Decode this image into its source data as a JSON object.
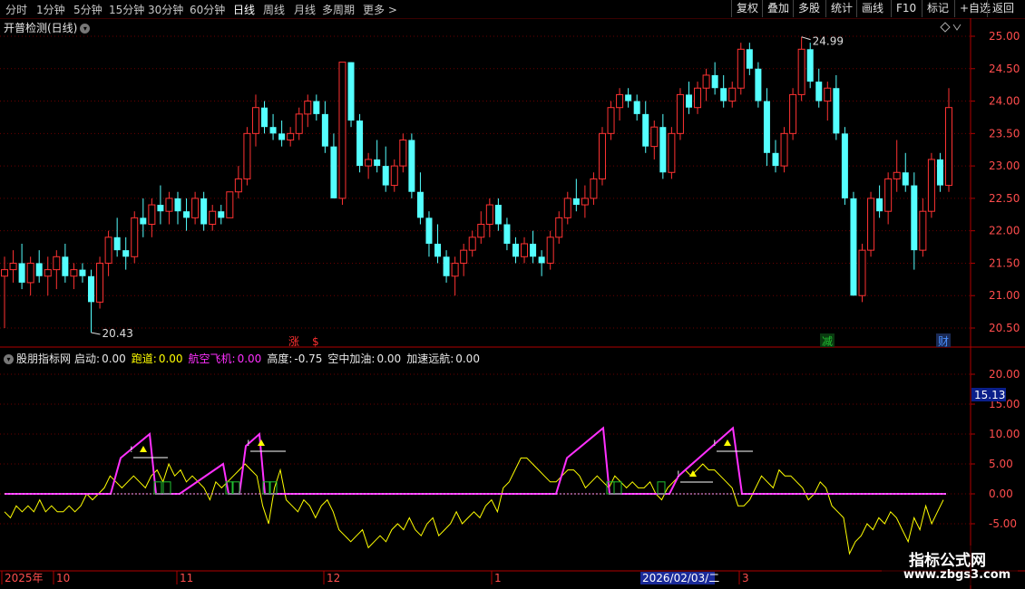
{
  "toolbar": {
    "periods": [
      "分时",
      "1分钟",
      "5分钟",
      "15分钟",
      "30分钟",
      "60分钟",
      "日线",
      "周线",
      "月线",
      "多周期",
      "更多 >"
    ],
    "active_period": "日线",
    "right_buttons": [
      "复权",
      "叠加",
      "多股",
      "统计",
      "画线",
      "F10",
      "标记",
      "+自选",
      "返回"
    ]
  },
  "main_chart": {
    "title": "开普检测(日线)",
    "high_label": "24.99",
    "low_label": "20.43",
    "price_ticks": [
      "25.00",
      "24.50",
      "24.00",
      "23.50",
      "23.00",
      "22.50",
      "22.00",
      "21.50",
      "21.00",
      "20.50"
    ],
    "markers": [
      {
        "text": "涨",
        "color": "#ff3030"
      },
      {
        "text": "$",
        "color": "#ff3030"
      },
      {
        "text": "减",
        "color": "#20c030"
      },
      {
        "text": "财",
        "color": "#4a90ff"
      }
    ]
  },
  "indicator": {
    "name": "股朋指标网",
    "items": [
      {
        "label": "启动:",
        "value": "0.00",
        "color": "#e8e8e8"
      },
      {
        "label": "跑道:",
        "value": "0.00",
        "color": "#ffff00"
      },
      {
        "label": "航空飞机:",
        "value": "0.00",
        "color": "#ff30ff"
      },
      {
        "label": "高度:",
        "value": "-0.75",
        "color": "#e8e8e8"
      },
      {
        "label": "空中加油:",
        "value": "0.00",
        "color": "#e8e8e8"
      },
      {
        "label": "加速远航:",
        "value": "0.00",
        "color": "#e8e8e8"
      }
    ],
    "ticks": [
      "20.00",
      "15.00",
      "10.00",
      "5.00",
      "0.00",
      "-5.00"
    ],
    "current_value": "15.13"
  },
  "time_axis": {
    "labels": [
      "2025年",
      "10",
      "11",
      "12",
      "1",
      "2",
      "3"
    ],
    "cursor_date": "2026/02/03/二"
  },
  "watermark": {
    "line1": "指标公式网",
    "line2": "www.zbgs3.com"
  },
  "colors": {
    "up": "#ff3232",
    "down": "#54ffff",
    "flat": "#ffffff",
    "axis": "#b00000",
    "yellow": "#ffff00",
    "magenta": "#ff30ff",
    "green": "#20c030"
  },
  "chart_data": {
    "type": "candlestick",
    "series": [
      {
        "values": [
          [
            21.3,
            21.6,
            20.5,
            21.4
          ],
          [
            21.4,
            21.7,
            21.2,
            21.5
          ],
          [
            21.5,
            21.8,
            21.1,
            21.2
          ],
          [
            21.2,
            21.6,
            21.0,
            21.5
          ],
          [
            21.5,
            21.7,
            21.2,
            21.3
          ],
          [
            21.3,
            21.6,
            21.0,
            21.4
          ],
          [
            21.4,
            21.7,
            21.1,
            21.6
          ],
          [
            21.6,
            21.8,
            21.2,
            21.3
          ],
          [
            21.3,
            21.5,
            21.1,
            21.4
          ],
          [
            21.4,
            21.5,
            21.2,
            21.3
          ],
          [
            21.3,
            21.4,
            20.43,
            20.9
          ],
          [
            20.9,
            21.6,
            20.8,
            21.5
          ],
          [
            21.5,
            22.0,
            21.3,
            21.9
          ],
          [
            21.9,
            22.2,
            21.6,
            21.7
          ],
          [
            21.7,
            21.9,
            21.4,
            21.6
          ],
          [
            21.6,
            22.3,
            21.5,
            22.2
          ],
          [
            22.2,
            22.5,
            21.9,
            22.1
          ],
          [
            22.1,
            22.5,
            21.9,
            22.4
          ],
          [
            22.4,
            22.7,
            22.1,
            22.3
          ],
          [
            22.3,
            22.6,
            22.1,
            22.5
          ],
          [
            22.5,
            22.6,
            22.1,
            22.3
          ],
          [
            22.3,
            22.5,
            22.0,
            22.2
          ],
          [
            22.2,
            22.6,
            22.1,
            22.5
          ],
          [
            22.5,
            22.6,
            22.0,
            22.1
          ],
          [
            22.1,
            22.4,
            22.0,
            22.3
          ],
          [
            22.3,
            22.4,
            22.1,
            22.2
          ],
          [
            22.2,
            22.6,
            22.2,
            22.6
          ],
          [
            22.6,
            23.0,
            22.5,
            22.8
          ],
          [
            22.8,
            23.6,
            22.7,
            23.5
          ],
          [
            23.5,
            24.1,
            23.3,
            23.9
          ],
          [
            23.9,
            24.0,
            23.5,
            23.6
          ],
          [
            23.6,
            23.8,
            23.4,
            23.5
          ],
          [
            23.5,
            23.7,
            23.3,
            23.4
          ],
          [
            23.4,
            23.6,
            23.3,
            23.5
          ],
          [
            23.5,
            23.9,
            23.4,
            23.8
          ],
          [
            23.8,
            24.1,
            23.6,
            24.0
          ],
          [
            24.0,
            24.1,
            23.7,
            23.8
          ],
          [
            23.8,
            24.0,
            23.2,
            23.3
          ],
          [
            23.3,
            23.5,
            22.6,
            22.5
          ],
          [
            22.5,
            24.6,
            22.4,
            24.6
          ],
          [
            24.6,
            24.6,
            23.6,
            23.7
          ],
          [
            23.7,
            23.8,
            22.9,
            23.0
          ],
          [
            23.0,
            23.2,
            22.8,
            23.1
          ],
          [
            23.1,
            23.4,
            22.9,
            23.0
          ],
          [
            23.0,
            23.3,
            22.6,
            22.7
          ],
          [
            22.7,
            23.1,
            22.6,
            23.0
          ],
          [
            23.0,
            23.5,
            22.9,
            23.4
          ],
          [
            23.4,
            23.5,
            22.5,
            22.6
          ],
          [
            22.6,
            22.9,
            22.1,
            22.2
          ],
          [
            22.2,
            22.3,
            21.6,
            21.8
          ],
          [
            21.8,
            22.1,
            21.5,
            21.6
          ],
          [
            21.6,
            21.7,
            21.2,
            21.3
          ],
          [
            21.3,
            21.6,
            21.0,
            21.5
          ],
          [
            21.5,
            21.8,
            21.3,
            21.7
          ],
          [
            21.7,
            22.0,
            21.6,
            21.9
          ],
          [
            21.9,
            22.3,
            21.8,
            22.1
          ],
          [
            22.1,
            22.5,
            21.9,
            22.4
          ],
          [
            22.4,
            22.5,
            22.0,
            22.1
          ],
          [
            22.1,
            22.2,
            21.7,
            21.8
          ],
          [
            21.8,
            21.9,
            21.5,
            21.6
          ],
          [
            21.6,
            21.9,
            21.5,
            21.8
          ],
          [
            21.8,
            22.0,
            21.5,
            21.6
          ],
          [
            21.6,
            21.7,
            21.3,
            21.5
          ],
          [
            21.5,
            22.0,
            21.4,
            21.9
          ],
          [
            21.9,
            22.3,
            21.8,
            22.2
          ],
          [
            22.2,
            22.6,
            22.1,
            22.5
          ],
          [
            22.5,
            22.8,
            22.3,
            22.4
          ],
          [
            22.4,
            22.7,
            22.2,
            22.5
          ],
          [
            22.5,
            22.9,
            22.4,
            22.8
          ],
          [
            22.8,
            23.6,
            22.7,
            23.5
          ],
          [
            23.5,
            24.0,
            23.4,
            23.9
          ],
          [
            23.9,
            24.2,
            23.7,
            24.1
          ],
          [
            24.1,
            24.2,
            23.9,
            24.0
          ],
          [
            24.0,
            24.1,
            23.7,
            23.8
          ],
          [
            23.8,
            24.0,
            23.2,
            23.3
          ],
          [
            23.3,
            23.7,
            23.1,
            23.6
          ],
          [
            23.6,
            23.8,
            22.8,
            22.9
          ],
          [
            22.9,
            23.6,
            22.8,
            23.5
          ],
          [
            23.5,
            24.2,
            23.4,
            24.1
          ],
          [
            24.1,
            24.3,
            23.8,
            23.9
          ],
          [
            23.9,
            24.3,
            23.8,
            24.2
          ],
          [
            24.2,
            24.5,
            24.0,
            24.4
          ],
          [
            24.4,
            24.6,
            24.1,
            24.2
          ],
          [
            24.2,
            24.4,
            23.9,
            24.0
          ],
          [
            24.0,
            24.3,
            23.9,
            24.2
          ],
          [
            24.2,
            24.9,
            24.1,
            24.8
          ],
          [
            24.8,
            24.9,
            24.4,
            24.5
          ],
          [
            24.5,
            24.6,
            23.9,
            24.0
          ],
          [
            24.0,
            24.2,
            23.0,
            23.2
          ],
          [
            23.2,
            23.4,
            22.9,
            23.0
          ],
          [
            23.0,
            23.6,
            22.9,
            23.5
          ],
          [
            23.5,
            24.2,
            23.4,
            24.1
          ],
          [
            24.1,
            24.99,
            24.0,
            24.8
          ],
          [
            24.8,
            24.9,
            24.2,
            24.3
          ],
          [
            24.3,
            24.5,
            23.9,
            24.0
          ],
          [
            24.0,
            24.3,
            23.7,
            24.2
          ],
          [
            24.2,
            24.4,
            23.4,
            23.5
          ],
          [
            23.5,
            23.6,
            22.4,
            22.5
          ],
          [
            22.5,
            22.6,
            21.0,
            21.0
          ],
          [
            21.0,
            21.8,
            20.9,
            21.7
          ],
          [
            21.7,
            22.6,
            21.6,
            22.5
          ],
          [
            22.5,
            22.7,
            22.2,
            22.3
          ],
          [
            22.3,
            22.9,
            22.1,
            22.8
          ],
          [
            22.8,
            23.4,
            22.6,
            22.9
          ],
          [
            22.9,
            23.2,
            22.6,
            22.7
          ],
          [
            22.7,
            22.9,
            21.4,
            21.7
          ],
          [
            21.7,
            22.5,
            21.6,
            22.3
          ],
          [
            22.3,
            23.2,
            22.2,
            23.1
          ],
          [
            23.1,
            23.2,
            22.6,
            22.7
          ],
          [
            22.7,
            24.2,
            22.6,
            23.9
          ]
        ]
      }
    ],
    "ylim": [
      20.43,
      24.99
    ],
    "ylabel": "",
    "xlabel": ""
  }
}
